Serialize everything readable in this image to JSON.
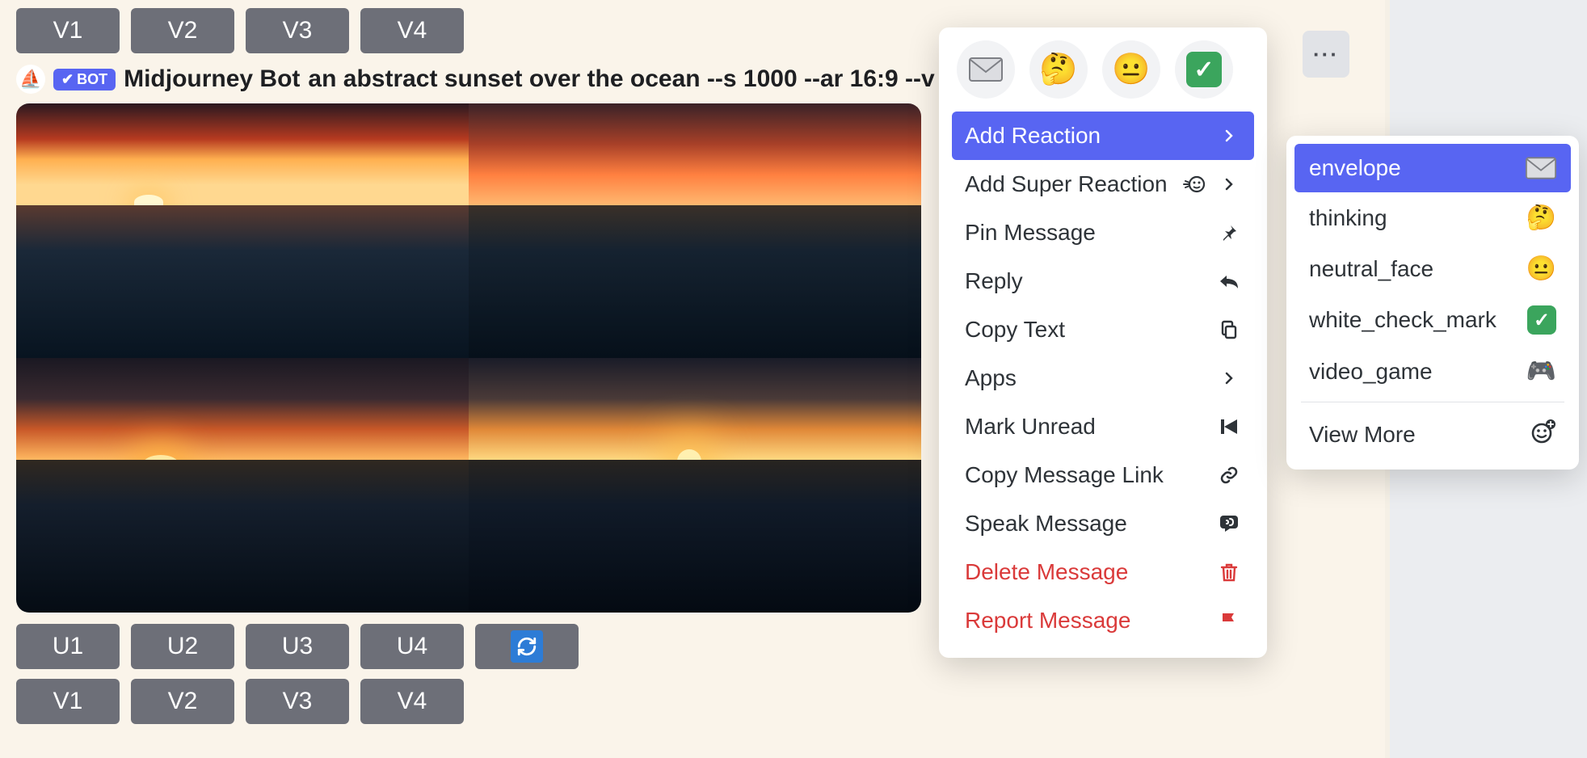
{
  "top_row": [
    "V1",
    "V2",
    "V3",
    "V4"
  ],
  "message": {
    "bot_name": "Midjourney Bot",
    "bot_badge": "BOT",
    "prompt": "an abstract sunset over the ocean --s 1000 --ar 16:9 --v"
  },
  "u_row": [
    "U1",
    "U2",
    "U3",
    "U4"
  ],
  "v_row": [
    "V1",
    "V2",
    "V3",
    "V4"
  ],
  "quick_reactions": [
    {
      "name": "envelope"
    },
    {
      "name": "thinking"
    },
    {
      "name": "neutral_face"
    },
    {
      "name": "white_check_mark"
    }
  ],
  "context_menu": [
    {
      "label": "Add Reaction",
      "icon": "chevron",
      "highlight": true,
      "danger": false
    },
    {
      "label": "Add Super Reaction",
      "icon": "super",
      "highlight": false,
      "danger": false
    },
    {
      "label": "Pin Message",
      "icon": "pin",
      "highlight": false,
      "danger": false
    },
    {
      "label": "Reply",
      "icon": "reply",
      "highlight": false,
      "danger": false
    },
    {
      "label": "Copy Text",
      "icon": "copy",
      "highlight": false,
      "danger": false
    },
    {
      "label": "Apps",
      "icon": "chevron",
      "highlight": false,
      "danger": false
    },
    {
      "label": "Mark Unread",
      "icon": "unread",
      "highlight": false,
      "danger": false
    },
    {
      "label": "Copy Message Link",
      "icon": "link",
      "highlight": false,
      "danger": false
    },
    {
      "label": "Speak Message",
      "icon": "speak",
      "highlight": false,
      "danger": false
    },
    {
      "label": "Delete Message",
      "icon": "trash",
      "highlight": false,
      "danger": true
    },
    {
      "label": "Report Message",
      "icon": "flag",
      "highlight": false,
      "danger": true
    }
  ],
  "emoji_menu": [
    {
      "label": "envelope",
      "glyph": "envelope",
      "highlight": true
    },
    {
      "label": "thinking",
      "glyph": "thinking",
      "highlight": false
    },
    {
      "label": "neutral_face",
      "glyph": "neutral",
      "highlight": false
    },
    {
      "label": "white_check_mark",
      "glyph": "check",
      "highlight": false
    },
    {
      "label": "video_game",
      "glyph": "gamepad",
      "highlight": false
    }
  ],
  "emoji_view_more": "View More"
}
